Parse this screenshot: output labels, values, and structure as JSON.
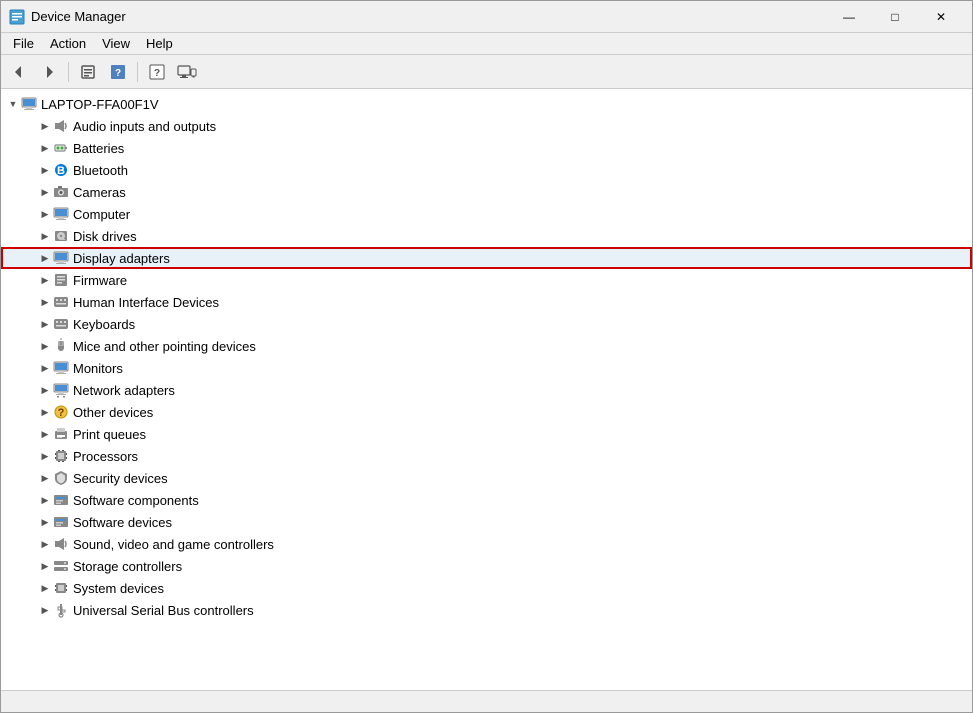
{
  "window": {
    "title": "Device Manager",
    "icon": "⚙"
  },
  "titlebar": {
    "minimize": "—",
    "maximize": "□",
    "close": "✕"
  },
  "menu": {
    "items": [
      "File",
      "Action",
      "View",
      "Help"
    ]
  },
  "toolbar": {
    "buttons": [
      {
        "name": "back",
        "icon": "◀",
        "label": "Back"
      },
      {
        "name": "forward",
        "icon": "▶",
        "label": "Forward"
      },
      {
        "name": "properties",
        "icon": "📋",
        "label": "Properties"
      },
      {
        "name": "update",
        "icon": "🔄",
        "label": "Update"
      },
      {
        "name": "help",
        "icon": "❓",
        "label": "Help"
      },
      {
        "name": "devices",
        "icon": "🖥",
        "label": "Devices"
      }
    ]
  },
  "tree": {
    "root": {
      "label": "LAPTOP-FFA00F1V",
      "expanded": true
    },
    "items": [
      {
        "id": "audio",
        "label": "Audio inputs and outputs",
        "icon": "🔊",
        "color": "#555"
      },
      {
        "id": "batteries",
        "label": "Batteries",
        "icon": "🔋",
        "color": "#555"
      },
      {
        "id": "bluetooth",
        "label": "Bluetooth",
        "icon": "🔷",
        "color": "#0078d7"
      },
      {
        "id": "cameras",
        "label": "Cameras",
        "icon": "📷",
        "color": "#555"
      },
      {
        "id": "computer",
        "label": "Computer",
        "icon": "🖥",
        "color": "#555"
      },
      {
        "id": "diskdrives",
        "label": "Disk drives",
        "icon": "💾",
        "color": "#555"
      },
      {
        "id": "displayadapters",
        "label": "Display adapters",
        "icon": "🖥",
        "color": "#555",
        "highlighted": true
      },
      {
        "id": "firmware",
        "label": "Firmware",
        "icon": "⚙",
        "color": "#555"
      },
      {
        "id": "hid",
        "label": "Human Interface Devices",
        "icon": "⌨",
        "color": "#555"
      },
      {
        "id": "keyboards",
        "label": "Keyboards",
        "icon": "⌨",
        "color": "#555"
      },
      {
        "id": "mice",
        "label": "Mice and other pointing devices",
        "icon": "🖱",
        "color": "#555"
      },
      {
        "id": "monitors",
        "label": "Monitors",
        "icon": "🖥",
        "color": "#555"
      },
      {
        "id": "network",
        "label": "Network adapters",
        "icon": "🌐",
        "color": "#555"
      },
      {
        "id": "other",
        "label": "Other devices",
        "icon": "❓",
        "color": "#555"
      },
      {
        "id": "print",
        "label": "Print queues",
        "icon": "🖨",
        "color": "#555"
      },
      {
        "id": "processors",
        "label": "Processors",
        "icon": "⚙",
        "color": "#555"
      },
      {
        "id": "security",
        "label": "Security devices",
        "icon": "🔒",
        "color": "#555"
      },
      {
        "id": "software",
        "label": "Software components",
        "icon": "📦",
        "color": "#555"
      },
      {
        "id": "softwaredev",
        "label": "Software devices",
        "icon": "📦",
        "color": "#555"
      },
      {
        "id": "sound",
        "label": "Sound, video and game controllers",
        "icon": "🔊",
        "color": "#555"
      },
      {
        "id": "storage",
        "label": "Storage controllers",
        "icon": "💾",
        "color": "#555"
      },
      {
        "id": "system",
        "label": "System devices",
        "icon": "⚙",
        "color": "#555"
      },
      {
        "id": "usb",
        "label": "Universal Serial Bus controllers",
        "icon": "🔌",
        "color": "#555"
      }
    ]
  },
  "statusbar": {
    "text": ""
  }
}
